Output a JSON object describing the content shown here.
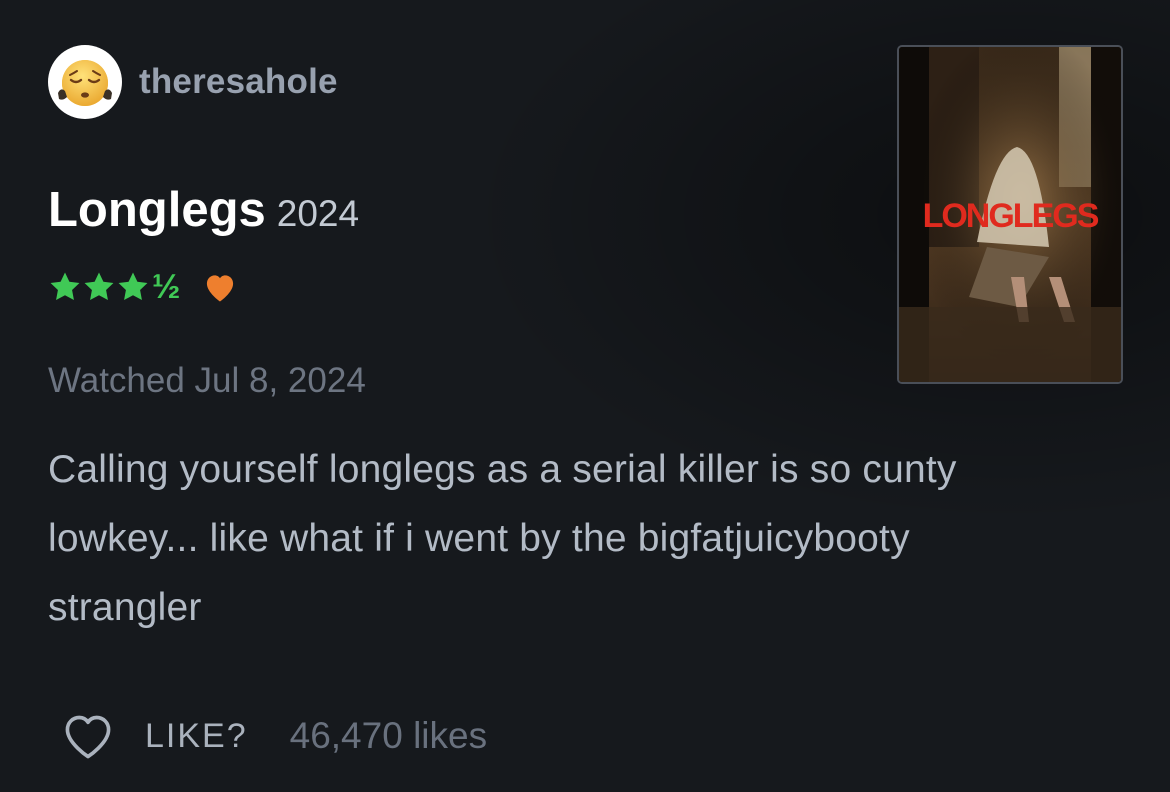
{
  "user": {
    "username": "theresahole",
    "avatar_icon": "pensive-face-emoji-icon"
  },
  "film": {
    "title": "Longlegs",
    "year": "2024",
    "poster_title": "LONGLEGS"
  },
  "rating": {
    "stars": 3.5,
    "half_glyph": "½",
    "liked": true,
    "star_color": "#40c956",
    "heart_color": "#ee7f2e"
  },
  "watched": "Watched Jul 8, 2024",
  "review": {
    "text": "Calling yourself longlegs as a serial killer is so cunty lowkey... like what if i went by the bigfatjuicybooty strangler"
  },
  "footer": {
    "like_label": "LIKE?",
    "likes_count": "46,470 likes",
    "heart_icon": "heart-outline-icon"
  }
}
